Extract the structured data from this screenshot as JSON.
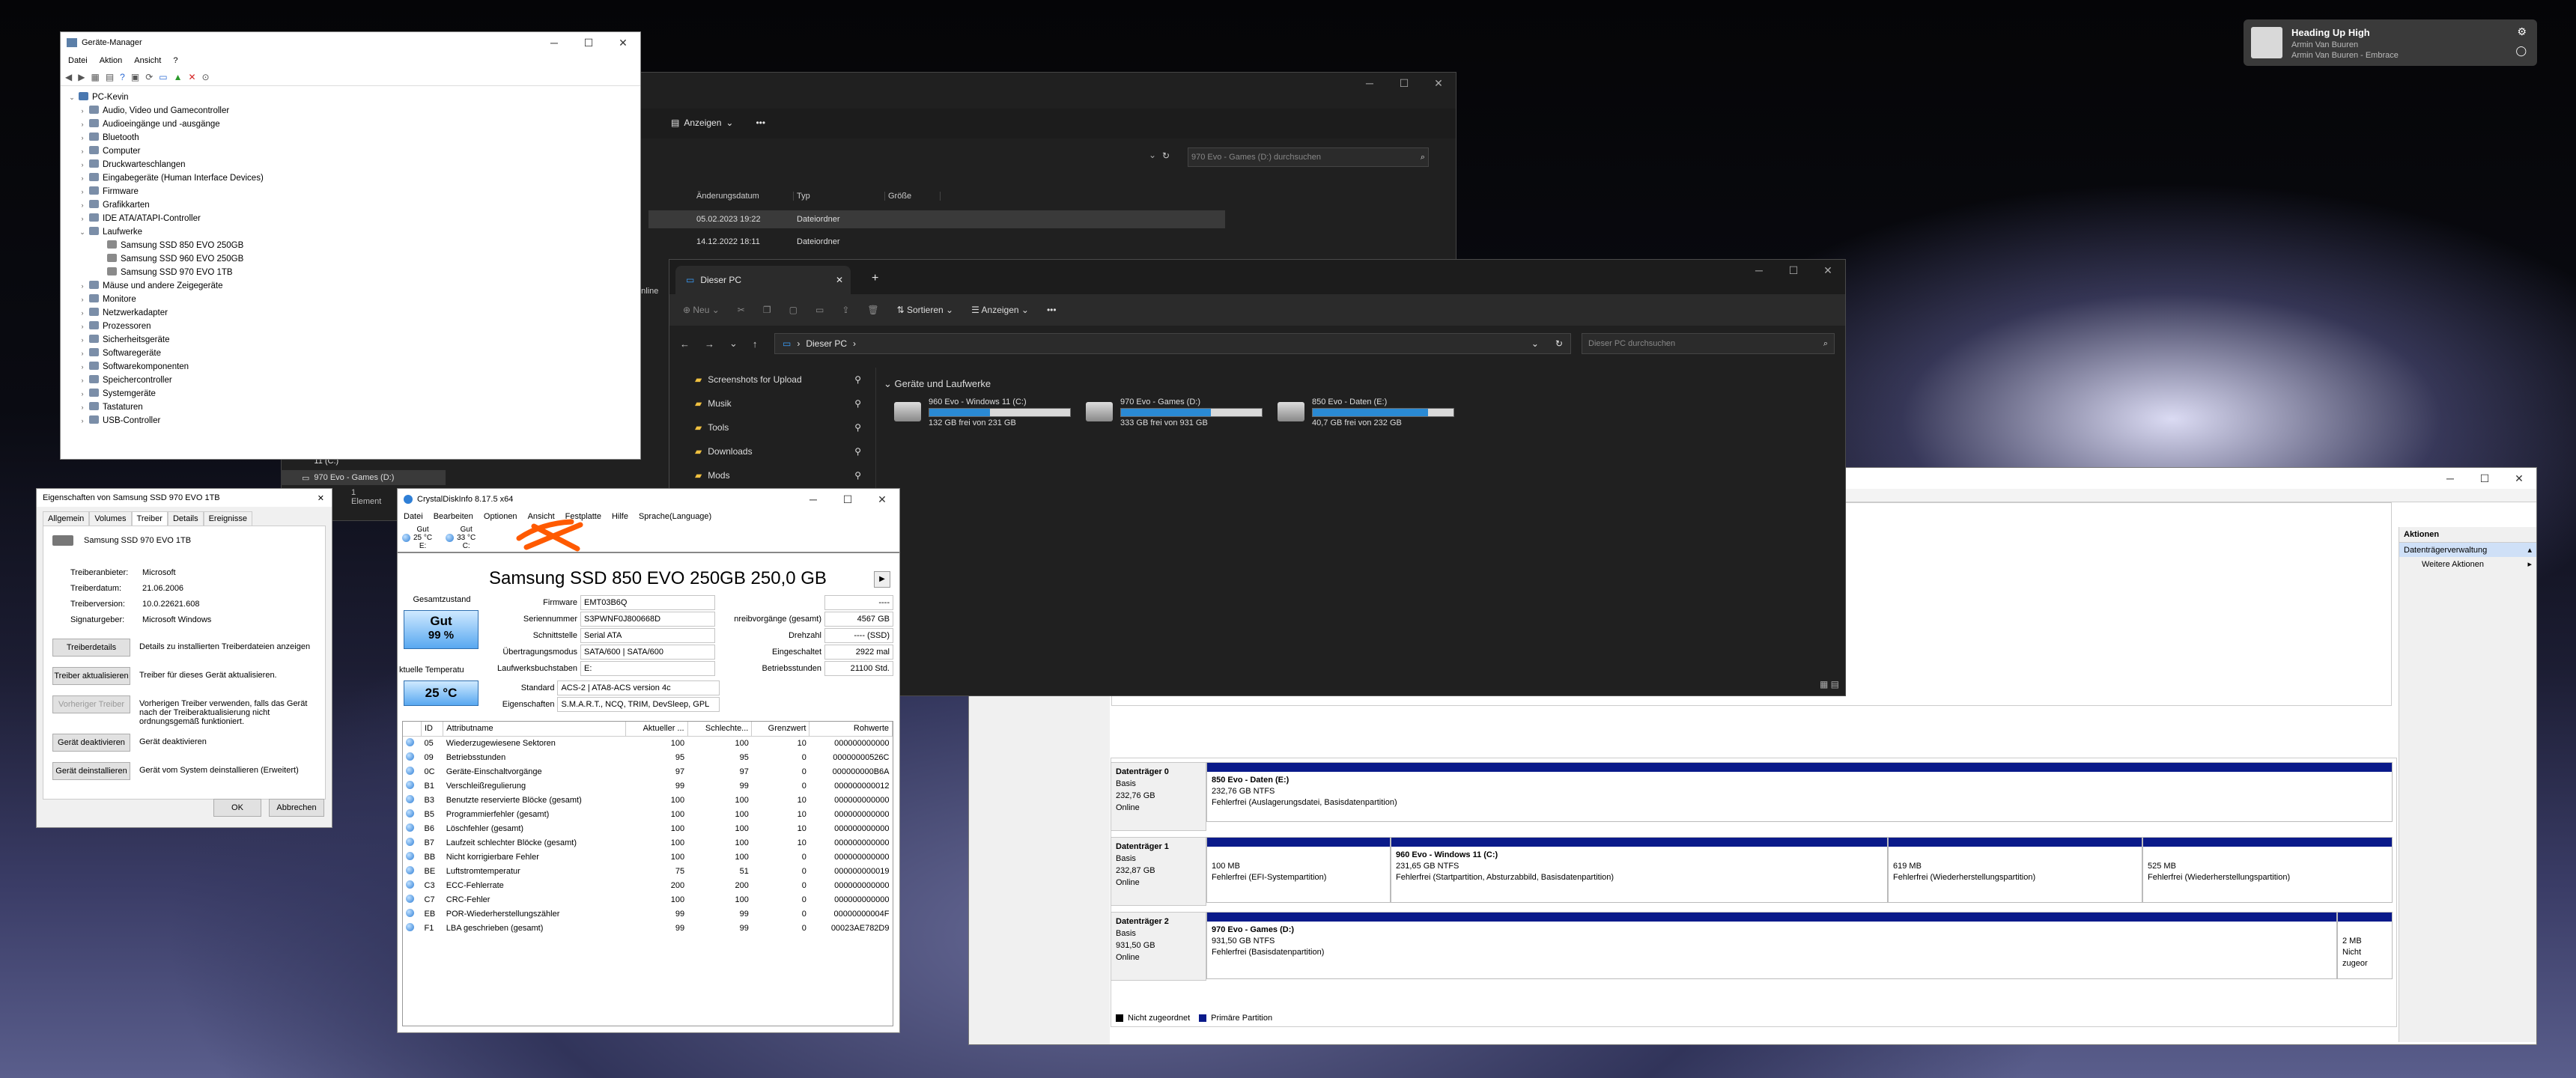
{
  "media": {
    "title": "Heading Up High",
    "artist": "Armin Van Buuren",
    "album": "Armin Van Buuren - Embrace"
  },
  "device_manager": {
    "title": "Geräte-Manager",
    "menu": [
      "Datei",
      "Aktion",
      "Ansicht",
      "?"
    ],
    "root": "PC-Kevin",
    "items": [
      {
        "label": "Audio, Video und Gamecontroller",
        "level": 1
      },
      {
        "label": "Audioeingänge und -ausgänge",
        "level": 1
      },
      {
        "label": "Bluetooth",
        "level": 1
      },
      {
        "label": "Computer",
        "level": 1
      },
      {
        "label": "Druckwarteschlangen",
        "level": 1
      },
      {
        "label": "Eingabegeräte (Human Interface Devices)",
        "level": 1
      },
      {
        "label": "Firmware",
        "level": 1
      },
      {
        "label": "Grafikkarten",
        "level": 1
      },
      {
        "label": "IDE ATA/ATAPI-Controller",
        "level": 1
      },
      {
        "label": "Laufwerke",
        "level": 1,
        "open": true
      },
      {
        "label": "Samsung SSD 850 EVO 250GB",
        "level": 2
      },
      {
        "label": "Samsung SSD 960 EVO 250GB",
        "level": 2
      },
      {
        "label": "Samsung SSD 970 EVO 1TB",
        "level": 2
      },
      {
        "label": "Mäuse und andere Zeigegeräte",
        "level": 1
      },
      {
        "label": "Monitore",
        "level": 1
      },
      {
        "label": "Netzwerkadapter",
        "level": 1
      },
      {
        "label": "Prozessoren",
        "level": 1
      },
      {
        "label": "Sicherheitsgeräte",
        "level": 1
      },
      {
        "label": "Softwaregeräte",
        "level": 1
      },
      {
        "label": "Softwarekomponenten",
        "level": 1
      },
      {
        "label": "Speichercontroller",
        "level": 1
      },
      {
        "label": "Systemgeräte",
        "level": 1
      },
      {
        "label": "Tastaturen",
        "level": 1
      },
      {
        "label": "USB-Controller",
        "level": 1
      }
    ]
  },
  "explorer_back": {
    "toolbar_view": "Anzeigen",
    "search_placeholder": "970 Evo - Games (D:) durchsuchen",
    "columns": [
      "Änderungsdatum",
      "Typ",
      "Größe"
    ],
    "rows": [
      [
        "05.02.2023 19:22",
        "Dateiordner"
      ],
      [
        "14.12.2022 18:11",
        "Dateiordner"
      ]
    ],
    "side_online": "online",
    "left_items": [
      "960 Evo - Windows 11 (C:)",
      "970 Evo - Games (D:)"
    ],
    "status": "1 Element"
  },
  "explorer": {
    "tab": "Dieser PC",
    "toolbar": {
      "new": "Neu",
      "sort": "Sortieren",
      "view": "Anzeigen"
    },
    "address": "Dieser PC",
    "search_placeholder": "Dieser PC durchsuchen",
    "quick": [
      "Screenshots for Upload",
      "Musik",
      "Tools",
      "Downloads",
      "Mods"
    ],
    "section": "Geräte und Laufwerke",
    "drives": [
      {
        "name": "960 Evo - Windows 11 (C:)",
        "free": "132 GB frei von 231 GB",
        "used_fraction": 0.43
      },
      {
        "name": "970 Evo - Games (D:)",
        "free": "333 GB frei von 931 GB",
        "used_fraction": 0.64
      },
      {
        "name": "850 Evo - Daten (E:)",
        "free": "40,7 GB frei von 232 GB",
        "used_fraction": 0.82
      }
    ]
  },
  "props": {
    "title": "Eigenschaften von Samsung SSD 970 EVO 1TB",
    "tabs": [
      "Allgemein",
      "Volumes",
      "Treiber",
      "Details",
      "Ereignisse"
    ],
    "device": "Samsung SSD 970 EVO 1TB",
    "info": [
      [
        "Treiberanbieter:",
        "Microsoft"
      ],
      [
        "Treiberdatum:",
        "21.06.2006"
      ],
      [
        "Treiberversion:",
        "10.0.22621.608"
      ],
      [
        "Signaturgeber:",
        "Microsoft Windows"
      ]
    ],
    "buttons": [
      {
        "label": "Treiberdetails",
        "desc": "Details zu installierten Treiberdateien anzeigen"
      },
      {
        "label": "Treiber aktualisieren",
        "desc": "Treiber für dieses Gerät aktualisieren."
      },
      {
        "label": "Vorheriger Treiber",
        "desc": "Vorherigen Treiber verwenden, falls das Gerät nach der Treiberaktualisierung nicht ordnungsgemäß funktioniert."
      },
      {
        "label": "Gerät deaktivieren",
        "desc": "Gerät deaktivieren"
      },
      {
        "label": "Gerät deinstallieren",
        "desc": "Gerät vom System deinstallieren (Erweitert)"
      }
    ],
    "ok": "OK",
    "cancel": "Abbrechen"
  },
  "crystal": {
    "title": "CrystalDiskInfo 8.17.5 x64",
    "menu": [
      "Datei",
      "Bearbeiten",
      "Optionen",
      "Ansicht",
      "Festplatte",
      "Hilfe",
      "Sprache(Language)"
    ],
    "disks": [
      {
        "status": "Gut",
        "temp": "25 °C",
        "letter": "E:"
      },
      {
        "status": "Gut",
        "temp": "33 °C",
        "letter": "C:"
      }
    ],
    "model": "Samsung SSD 850 EVO 250GB 250,0 GB",
    "health_label": "Gesamtzustand",
    "health": "Gut",
    "health_pct": "99 %",
    "temp_label": "ktuelle Temperatu",
    "temp": "25 °C",
    "fields": [
      [
        "Firmware",
        "EMT03B6Q"
      ],
      [
        "Seriennummer",
        "S3PWNF0J800668D"
      ],
      [
        "Schnittstelle",
        "Serial ATA"
      ],
      [
        "Übertragungsmodus",
        "SATA/600 | SATA/600"
      ],
      [
        "Laufwerksbuchstaben",
        "E:"
      ],
      [
        "Standard",
        "ACS-2 | ATA8-ACS version 4c"
      ],
      [
        "Eigenschaften",
        "S.M.A.R.T., NCQ, TRIM, DevSleep, GPL"
      ]
    ],
    "right_fields": [
      [
        "",
        "----"
      ],
      [
        "nreibvorgänge (gesamt)",
        "4567 GB"
      ],
      [
        "Drehzahl",
        "---- (SSD)"
      ],
      [
        "Eingeschaltet",
        "2922 mal"
      ],
      [
        "Betriebsstunden",
        "21100 Std."
      ]
    ],
    "smart_headers": [
      "",
      "ID",
      "Attributname",
      "Aktueller ...",
      "Schlechte...",
      "Grenzwert",
      "Rohwerte"
    ],
    "smart": [
      [
        "05",
        "Wiederzugewiesene Sektoren",
        "100",
        "100",
        "10",
        "000000000000"
      ],
      [
        "09",
        "Betriebsstunden",
        "95",
        "95",
        "0",
        "00000000526C"
      ],
      [
        "0C",
        "Geräte-Einschaltvorgänge",
        "97",
        "97",
        "0",
        "000000000B6A"
      ],
      [
        "B1",
        "Verschleißregulierung",
        "99",
        "99",
        "0",
        "000000000012"
      ],
      [
        "B3",
        "Benutzte reservierte Blöcke (gesamt)",
        "100",
        "100",
        "10",
        "000000000000"
      ],
      [
        "B5",
        "Programmierfehler (gesamt)",
        "100",
        "100",
        "10",
        "000000000000"
      ],
      [
        "B6",
        "Löschfehler (gesamt)",
        "100",
        "100",
        "10",
        "000000000000"
      ],
      [
        "B7",
        "Laufzeit schlechter Blöcke (gesamt)",
        "100",
        "100",
        "10",
        "000000000000"
      ],
      [
        "BB",
        "Nicht korrigierbare Fehler",
        "100",
        "100",
        "0",
        "000000000000"
      ],
      [
        "BE",
        "Luftstromtemperatur",
        "75",
        "51",
        "0",
        "000000000019"
      ],
      [
        "C3",
        "ECC-Fehlerrate",
        "200",
        "200",
        "0",
        "000000000000"
      ],
      [
        "C7",
        "CRC-Fehler",
        "100",
        "100",
        "0",
        "000000000000"
      ],
      [
        "EB",
        "POR-Wiederherstellungszähler",
        "99",
        "99",
        "0",
        "00000000004F"
      ],
      [
        "F1",
        "LBA geschrieben (gesamt)",
        "99",
        "99",
        "0",
        "00023AE782D9"
      ]
    ]
  },
  "diskmgmt": {
    "actions_title": "Aktionen",
    "action_primary": "Datenträgerverwaltung",
    "action_more": "Weitere Aktionen",
    "disks": [
      {
        "name": "Datenträger 0",
        "type": "Basis",
        "size": "232,76 GB",
        "state": "Online",
        "parts": [
          {
            "name": "850 Evo - Daten (E:)",
            "detail": "232,76 GB NTFS",
            "status": "Fehlerfrei (Auslagerungsdatei, Basisdatenpartition)"
          }
        ]
      },
      {
        "name": "Datenträger 1",
        "type": "Basis",
        "size": "232,87 GB",
        "state": "Online",
        "parts": [
          {
            "name": "",
            "detail": "100 MB",
            "status": "Fehlerfrei (EFI-Systempartition)"
          },
          {
            "name": "960 Evo - Windows 11 (C:)",
            "detail": "231,65 GB NTFS",
            "status": "Fehlerfrei (Startpartition, Absturzabbild, Basisdatenpartition)"
          },
          {
            "name": "",
            "detail": "619 MB",
            "status": "Fehlerfrei (Wiederherstellungspartition)"
          },
          {
            "name": "",
            "detail": "525 MB",
            "status": "Fehlerfrei (Wiederherstellungspartition)"
          }
        ]
      },
      {
        "name": "Datenträger 2",
        "type": "Basis",
        "size": "931,50 GB",
        "state": "Online",
        "parts": [
          {
            "name": "970 Evo - Games (D:)",
            "detail": "931,50 GB NTFS",
            "status": "Fehlerfrei (Basisdatenpartition)"
          },
          {
            "name": "",
            "detail": "2 MB",
            "status": "Nicht zugeor"
          }
        ]
      }
    ],
    "legend": [
      "Nicht zugeordnet",
      "Primäre Partition"
    ]
  }
}
